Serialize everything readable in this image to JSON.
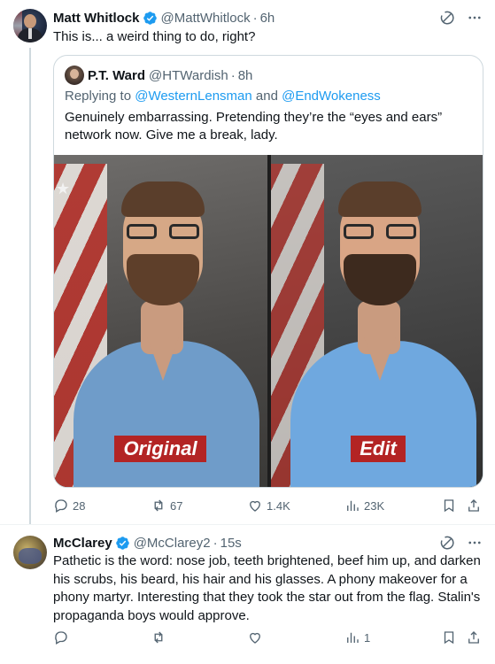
{
  "tweet1": {
    "name": "Matt Whitlock",
    "handle": "@MattWhitlock",
    "dot": "·",
    "time": "6h",
    "text": "This is... a weird thing to do, right?",
    "quote": {
      "name": "P.T. Ward",
      "handle": "@HTWardish",
      "dot": "·",
      "time": "8h",
      "replying_prefix": "Replying to ",
      "mention1": "@WesternLensman",
      "replying_and": " and ",
      "mention2": "@EndWokeness",
      "text": "Genuinely embarrassing. Pretending they’re the “eyes and ears” network now. Give me a break, lady.",
      "image_labels": {
        "left": "Original",
        "right": "Edit"
      }
    },
    "actions": {
      "replies": "28",
      "reposts": "67",
      "likes": "1.4K",
      "views": "23K"
    }
  },
  "tweet2": {
    "name": "McClarey",
    "handle": "@McClarey2",
    "dot": "·",
    "time": "15s",
    "text": "Pathetic is the word:  nose job, teeth brightened, beef him up, and darken his scrubs, his beard, his hair and his glasses.  A phony makeover for a phony martyr.  Interesting that they took the star out from the flag.  Stalin's propaganda boys would approve.",
    "actions": {
      "replies": "",
      "reposts": "",
      "likes": "",
      "views": "1"
    }
  },
  "icons": {
    "verified": "verified-badge-icon",
    "grok": "grok-icon",
    "more": "more-icon",
    "reply": "reply-icon",
    "repost": "repost-icon",
    "like": "like-icon",
    "views": "views-icon",
    "bookmark": "bookmark-icon",
    "share": "share-icon"
  },
  "colors": {
    "accent": "#1d9bf0",
    "secondary_text": "#536471",
    "label_red": "#b32424"
  }
}
